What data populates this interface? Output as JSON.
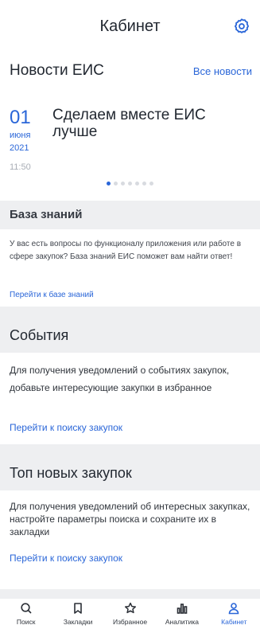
{
  "header": {
    "title": "Кабинет",
    "settings_icon": "gear-icon"
  },
  "news": {
    "title": "Новости ЕИС",
    "all_link": "Все новости",
    "item": {
      "day": "01",
      "month": "июня",
      "year": "2021",
      "time": "11:50",
      "headline": "Сделаем вместе ЕИС лучше"
    },
    "dots_count": 7,
    "active_dot": 1
  },
  "knowledge": {
    "title": "База знаний",
    "body": "У вас есть вопросы по функционалу приложения или работе в сфере закупок? База знаний ЕИС поможет вам найти ответ!",
    "link": "Перейти к базе знаний"
  },
  "events": {
    "title": "События",
    "body": "Для получения уведомлений о событиях закупок, добавьте интересующие закупки в избранное",
    "link": "Перейти к поиску закупок"
  },
  "top": {
    "title": "Топ новых закупок",
    "body": "Для получения уведомлений об интересных закупках, настройте параметры поиска и сохраните их в закладки",
    "link": "Перейти к поиску закупок"
  },
  "tabs": [
    {
      "label": "Поиск",
      "icon": "search-icon",
      "active": false
    },
    {
      "label": "Закладки",
      "icon": "bookmark-icon",
      "active": false
    },
    {
      "label": "Избранное",
      "icon": "star-icon",
      "active": false
    },
    {
      "label": "Аналитика",
      "icon": "chart-icon",
      "active": false
    },
    {
      "label": "Кабинет",
      "icon": "user-icon",
      "active": true
    }
  ],
  "colors": {
    "accent": "#2a66d8",
    "section_bg": "#eeeff1",
    "text": "#222831"
  }
}
